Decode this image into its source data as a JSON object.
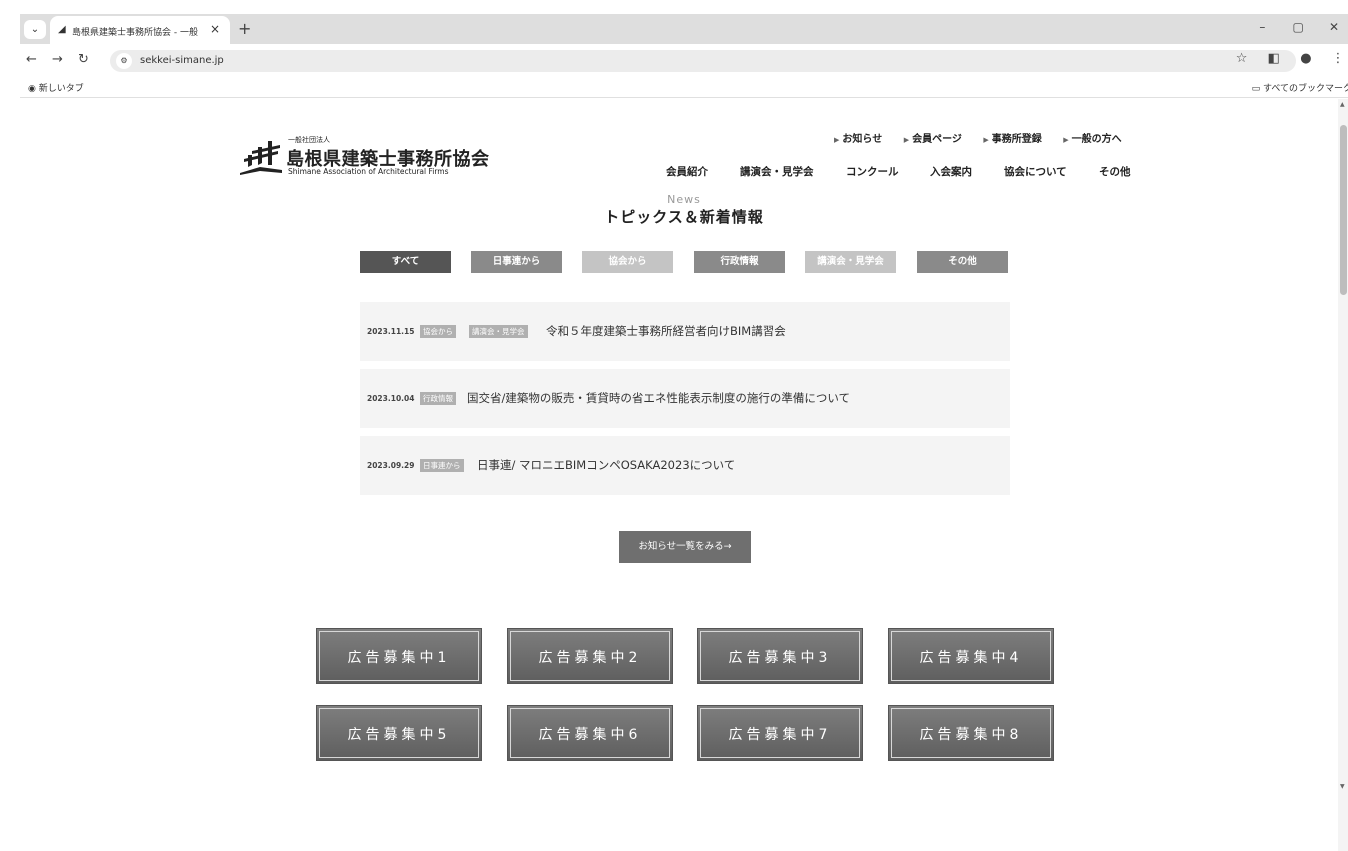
{
  "browser": {
    "tab_title": "島根県建築士事務所協会 - 一般",
    "new_tab_symbol": "+",
    "tab_close_symbol": "×",
    "url": "sekkei-simane.jp",
    "bookmark_newtab": "新しいタブ",
    "bookmark_all": "すべてのブックマーク",
    "window_controls": [
      "–",
      "▢",
      "✕"
    ]
  },
  "site": {
    "logo_sub": "一般社団法人",
    "logo_main": "島根県建築士事務所協会",
    "logo_en": "Shimane Association of Architectural Firms",
    "top_links": [
      "お知らせ",
      "会員ページ",
      "事務所登録",
      "一般の方へ"
    ],
    "main_nav": [
      "会員紹介",
      "講演会・見学会",
      "コンクール",
      "入会案内",
      "協会について",
      "その他"
    ]
  },
  "news": {
    "heading_en": "News",
    "heading_ja": "トピックス＆新着情報",
    "filters": [
      "すべて",
      "日事連から",
      "協会から",
      "行政情報",
      "講演会・見学会",
      "その他"
    ],
    "filter_colors": [
      "#555555",
      "#8a8a8a",
      "#c4c4c4",
      "#8a8a8a",
      "#c4c4c4",
      "#8a8a8a"
    ],
    "items": [
      {
        "date": "2023.11.15",
        "tags": [
          "協会から",
          "講演会・見学会"
        ],
        "title": "令和５年度建築士事務所経営者向けBIM講習会"
      },
      {
        "date": "2023.10.04",
        "tags": [
          "行政情報"
        ],
        "title": "国交省/建築物の販売・賃貸時の省エネ性能表示制度の施行の準備について"
      },
      {
        "date": "2023.09.29",
        "tags": [
          "日事連から"
        ],
        "title": "日事連/ マロニエBIMコンペOSAKA2023について"
      }
    ],
    "more_label": "お知らせ一覧をみる→"
  },
  "ads": [
    "広告募集中1",
    "広告募集中2",
    "広告募集中3",
    "広告募集中4",
    "広告募集中5",
    "広告募集中6",
    "広告募集中7",
    "広告募集中8"
  ]
}
